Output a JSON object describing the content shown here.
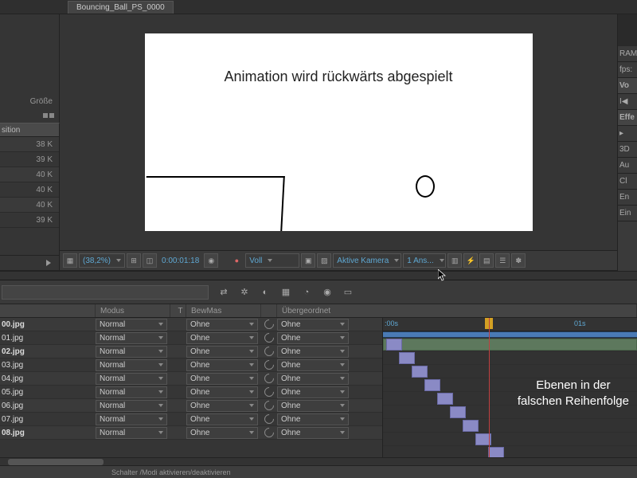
{
  "header": {
    "comp_tab": "Bouncing_Ball_PS_0000"
  },
  "left_panel": {
    "size_label": "Größe",
    "position_label": "sition",
    "sizes": [
      "38 K",
      "39 K",
      "40 K",
      "40 K",
      "40 K",
      "39 K"
    ]
  },
  "canvas": {
    "overlay_text": "Animation wird rückwärts abgespielt"
  },
  "viewer_toolbar": {
    "zoom": "(38,2%)",
    "timecode": "0:00:01:18",
    "resolution": "Voll",
    "camera": "Aktive Kamera",
    "views": "1 Ans..."
  },
  "right_panel": {
    "ram": "RAM",
    "fps": "fps:",
    "preview": "Vo",
    "effects": "Effe",
    "items": [
      "▸",
      "3D",
      "Au",
      "Cl",
      "En",
      "Ein"
    ]
  },
  "timeline": {
    "columns": {
      "mode": "Modus",
      "t": "T",
      "track_matte": "BewMas",
      "parent": "Übergeordnet"
    },
    "mode_value": "Normal",
    "matte_value": "Ohne",
    "parent_value": "Ohne",
    "ruler": {
      "t0": ":00s",
      "t1": "01s"
    },
    "layers": [
      {
        "name": "00.jpg",
        "bold": true,
        "start": 0
      },
      {
        "name": "01.jpg",
        "bold": false,
        "start": 1
      },
      {
        "name": "02.jpg",
        "bold": true,
        "start": 2
      },
      {
        "name": "03.jpg",
        "bold": false,
        "start": 3
      },
      {
        "name": "04.jpg",
        "bold": false,
        "start": 4
      },
      {
        "name": "05.jpg",
        "bold": false,
        "start": 5
      },
      {
        "name": "06.jpg",
        "bold": false,
        "start": 6
      },
      {
        "name": "07.jpg",
        "bold": false,
        "start": 7
      },
      {
        "name": "08.jpg",
        "bold": true,
        "start": 8
      }
    ],
    "annotation": "Ebenen in der\nfalschen Reihenfolge",
    "footer": "Schalter /Modi aktivieren/deaktivieren"
  }
}
